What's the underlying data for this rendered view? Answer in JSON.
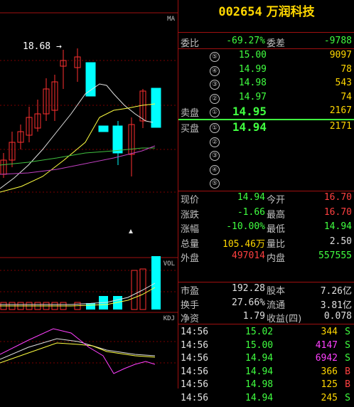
{
  "chart": {
    "ma_label": "MA",
    "vol_label": "VOL",
    "kdj_label": "KDJ",
    "high_label": "18.68",
    "arrow": "→"
  },
  "stock": {
    "code": "002654",
    "name": "万润科技"
  },
  "quote": {
    "wei_bi_label": "委比",
    "wei_bi": "-69.27%",
    "wei_cha_label": "委差",
    "wei_cha": "-9788",
    "sell_label": "卖盘",
    "buy_label": "买盘",
    "sells": [
      {
        "n": "⑤",
        "price": "15.00",
        "vol": "9097"
      },
      {
        "n": "④",
        "price": "14.99",
        "vol": "78"
      },
      {
        "n": "③",
        "price": "14.98",
        "vol": "543"
      },
      {
        "n": "②",
        "price": "14.97",
        "vol": "74"
      },
      {
        "n": "①",
        "price": "14.95",
        "vol": "2167"
      }
    ],
    "buys": [
      {
        "n": "①",
        "price": "14.94",
        "vol": "2171"
      },
      {
        "n": "②",
        "price": "",
        "vol": ""
      },
      {
        "n": "③",
        "price": "",
        "vol": ""
      },
      {
        "n": "④",
        "price": "",
        "vol": ""
      },
      {
        "n": "⑤",
        "price": "",
        "vol": ""
      }
    ]
  },
  "stats": [
    {
      "l1": "现价",
      "v1": "14.94",
      "c1": "green",
      "l2": "今开",
      "v2": "16.70",
      "c2": "red"
    },
    {
      "l1": "涨跌",
      "v1": "-1.66",
      "c1": "green",
      "l2": "最高",
      "v2": "16.70",
      "c2": "red"
    },
    {
      "l1": "涨幅",
      "v1": "-10.00%",
      "c1": "green",
      "l2": "最低",
      "v2": "14.94",
      "c2": "green"
    },
    {
      "l1": "总量",
      "v1": "105.46万",
      "c1": "yellow",
      "l2": "量比",
      "v2": "2.50",
      "c2": "white"
    },
    {
      "l1": "外盘",
      "v1": "497014",
      "c1": "red",
      "l2": "内盘",
      "v2": "557555",
      "c2": "green"
    }
  ],
  "stats2": [
    {
      "l1": "市盈",
      "v1": "192.28",
      "l2": "股本",
      "v2": "7.26亿"
    },
    {
      "l1": "换手",
      "v1": "27.66%",
      "l2": "流通",
      "v2": "3.81亿"
    },
    {
      "l1": "净资",
      "v1": "1.79",
      "l2": "收益(四)",
      "v2": "0.078"
    }
  ],
  "ticks": [
    {
      "time": "14:56",
      "price": "15.02",
      "vol": "344",
      "vc": "yellow",
      "bs": "S",
      "bc": "green"
    },
    {
      "time": "14:56",
      "price": "15.00",
      "vol": "4147",
      "vc": "magenta",
      "bs": "S",
      "bc": "green"
    },
    {
      "time": "14:56",
      "price": "14.94",
      "vol": "6942",
      "vc": "magenta",
      "bs": "S",
      "bc": "green"
    },
    {
      "time": "14:56",
      "price": "14.94",
      "vol": "366",
      "vc": "yellow",
      "bs": "B",
      "bc": "red"
    },
    {
      "time": "14:56",
      "price": "14.98",
      "vol": "125",
      "vc": "yellow",
      "bs": "B",
      "bc": "red"
    },
    {
      "time": "14:56",
      "price": "14.94",
      "vol": "245",
      "vc": "yellow",
      "bs": "S",
      "bc": "green"
    }
  ]
}
